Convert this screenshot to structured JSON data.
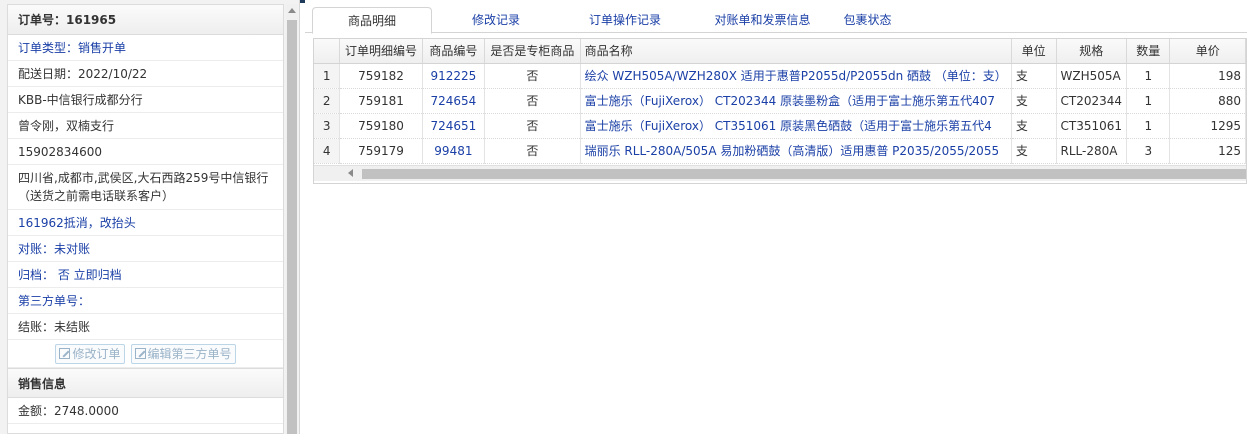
{
  "order": {
    "title": "订单号：161965",
    "rows": [
      {
        "text": "订单类型：销售开单",
        "blue": true
      },
      {
        "text": "配送日期：2022/10/22",
        "blue": false
      },
      {
        "text": "KBB-中信银行成都分行",
        "blue": false
      },
      {
        "text": "曾令刚，双楠支行",
        "blue": false
      },
      {
        "text": "15902834600",
        "blue": false
      },
      {
        "text": "四川省,成都市,武侯区,大石西路259号中信银行（送货之前需电话联系客户）",
        "blue": false,
        "tall": true
      },
      {
        "text": "161962抵消，改抬头",
        "blue": true
      },
      {
        "text": "对账：未对账",
        "blue": true
      },
      {
        "text": "归档： 否 立即归档",
        "blue": true
      },
      {
        "text": "第三方单号：",
        "blue": true
      },
      {
        "text": "结账：未结账",
        "blue": false
      }
    ],
    "buttons": {
      "edit_order": "修改订单",
      "edit_third_party": "编辑第三方单号"
    }
  },
  "sales": {
    "title": "销售信息",
    "amount": "金额：2748.0000"
  },
  "tabs": [
    {
      "label": "商品明细",
      "active": true
    },
    {
      "label": "修改记录",
      "active": false
    },
    {
      "label": "订单操作记录",
      "active": false
    },
    {
      "label": "对账单和发票信息",
      "active": false
    },
    {
      "label": "包裹状态",
      "active": false
    }
  ],
  "grid": {
    "columns": [
      "",
      "订单明细编号",
      "商品编号",
      "是否是专柜商品",
      "商品名称",
      "单位",
      "规格",
      "数量",
      "单价"
    ],
    "rows": [
      {
        "n": "1",
        "detail_id": "759182",
        "product_id": "912225",
        "counter": "否",
        "name": "绘众 WZH505A/WZH280X 适用于惠普P2055d/P2055dn 硒鼓 （单位：支）",
        "unit": "支",
        "spec": "WZH505A",
        "qty": "1",
        "price": "198"
      },
      {
        "n": "2",
        "detail_id": "759181",
        "product_id": "724654",
        "counter": "否",
        "name": "富士施乐（FujiXerox） CT202344 原装墨粉盒（适用于富士施乐第五代407",
        "unit": "支",
        "spec": "CT202344",
        "qty": "1",
        "price": "880"
      },
      {
        "n": "3",
        "detail_id": "759180",
        "product_id": "724651",
        "counter": "否",
        "name": "富士施乐（FujiXerox） CT351061 原装黑色硒鼓（适用于富士施乐第五代4",
        "unit": "支",
        "spec": "CT351061",
        "qty": "1",
        "price": "1295"
      },
      {
        "n": "4",
        "detail_id": "759179",
        "product_id": "99481",
        "counter": "否",
        "name": "瑞丽乐 RLL-280A/505A 易加粉硒鼓（高清版）适用惠普 P2035/2055/2055",
        "unit": "支",
        "spec": "RLL-280A",
        "qty": "3",
        "price": "125"
      }
    ]
  }
}
